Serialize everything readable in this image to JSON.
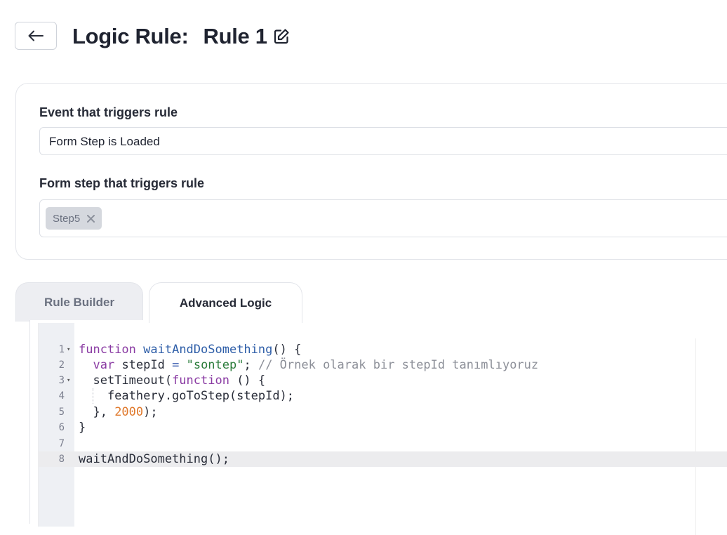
{
  "header": {
    "title_prefix": "Logic Rule:",
    "rule_name": "Rule 1"
  },
  "trigger_card": {
    "event_label": "Event that triggers rule",
    "event_value": "Form Step is Loaded",
    "step_label": "Form step that triggers rule",
    "step_chips": [
      "Step5"
    ]
  },
  "tabs": [
    {
      "label": "Rule Builder",
      "active": false
    },
    {
      "label": "Advanced Logic",
      "active": true
    }
  ],
  "editor": {
    "line_numbers": [
      "1",
      "2",
      "3",
      "4",
      "5",
      "6",
      "7",
      "8"
    ],
    "active_line": 8,
    "lines": [
      [
        {
          "t": "function",
          "c": "kw"
        },
        {
          "t": " "
        },
        {
          "t": "waitAndDoSomething",
          "c": "fn"
        },
        {
          "t": "() {"
        }
      ],
      [
        {
          "t": "  "
        },
        {
          "t": "var",
          "c": "kw"
        },
        {
          "t": " stepId "
        },
        {
          "t": "=",
          "c": "op"
        },
        {
          "t": " "
        },
        {
          "t": "\"sontep\"",
          "c": "str"
        },
        {
          "t": "; "
        },
        {
          "t": "// Örnek olarak bir stepId tanımlıyoruz",
          "c": "cm"
        }
      ],
      [
        {
          "t": "  setTimeout("
        },
        {
          "t": "function",
          "c": "kw"
        },
        {
          "t": " () {"
        }
      ],
      [
        {
          "t": "    feathery.goToStep(stepId);"
        }
      ],
      [
        {
          "t": "  }, "
        },
        {
          "t": "2000",
          "c": "num"
        },
        {
          "t": ");"
        }
      ],
      [
        {
          "t": "}"
        }
      ],
      [
        {
          "t": ""
        }
      ],
      [
        {
          "t": "waitAndDoSomething();"
        }
      ]
    ]
  }
}
